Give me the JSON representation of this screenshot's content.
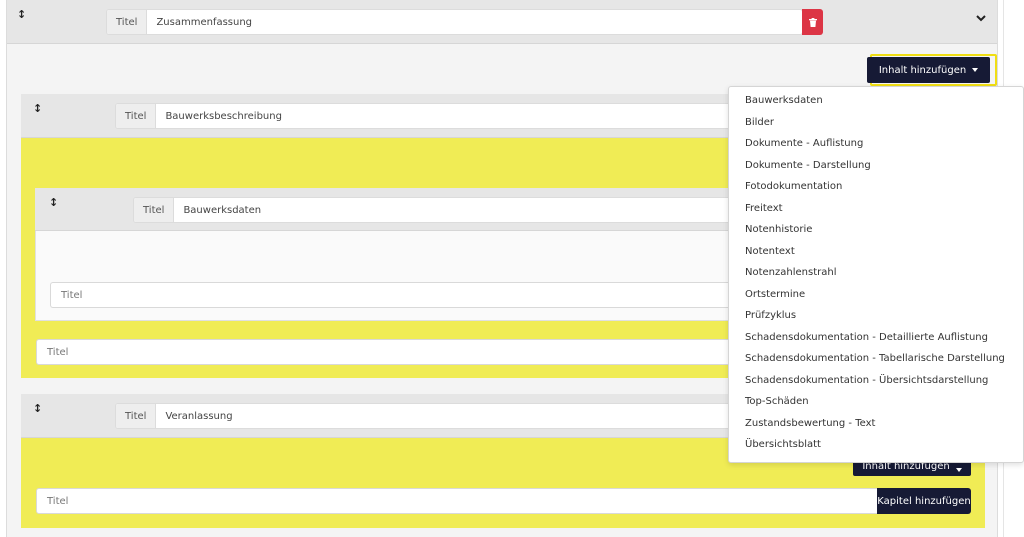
{
  "common": {
    "titel_label": "Titel",
    "titel_placeholder": "Titel"
  },
  "top_section": {
    "title_value": "Zusammenfassung"
  },
  "toolbar": {
    "add_content_label": "Inhalt hinzufügen",
    "add_chapter_label": "Kapitel hinzufügen"
  },
  "sections": {
    "bauwerksbeschreibung": {
      "title_value": "Bauwerksbeschreibung"
    },
    "bauwerksdaten": {
      "title_value": "Bauwerksdaten"
    },
    "veranlassung": {
      "title_value": "Veranlassung"
    }
  },
  "dropdown": {
    "items": [
      "Bauwerksdaten",
      "Bilder",
      "Dokumente - Auflistung",
      "Dokumente - Darstellung",
      "Fotodokumentation",
      "Freitext",
      "Notenhistorie",
      "Notentext",
      "Notenzahlenstrahl",
      "Ortstermine",
      "Prüfzyklus",
      "Schadensdokumentation - Detaillierte Auflistung",
      "Schadensdokumentation - Tabellarische Darstellung",
      "Schadensdokumentation - Übersichtsdarstellung",
      "Top-Schäden",
      "Zustandsbewertung - Text",
      "Übersichtsblatt"
    ]
  },
  "colors": {
    "accent_dark": "#161a35",
    "danger": "#dc3545",
    "highlight_yellow": "#f0ec55",
    "focus_outline": "#f0de13"
  },
  "icons": {
    "drag": "vertical-resize-arrow-icon",
    "trash": "trash-icon",
    "collapse": "chevron-down-icon"
  }
}
